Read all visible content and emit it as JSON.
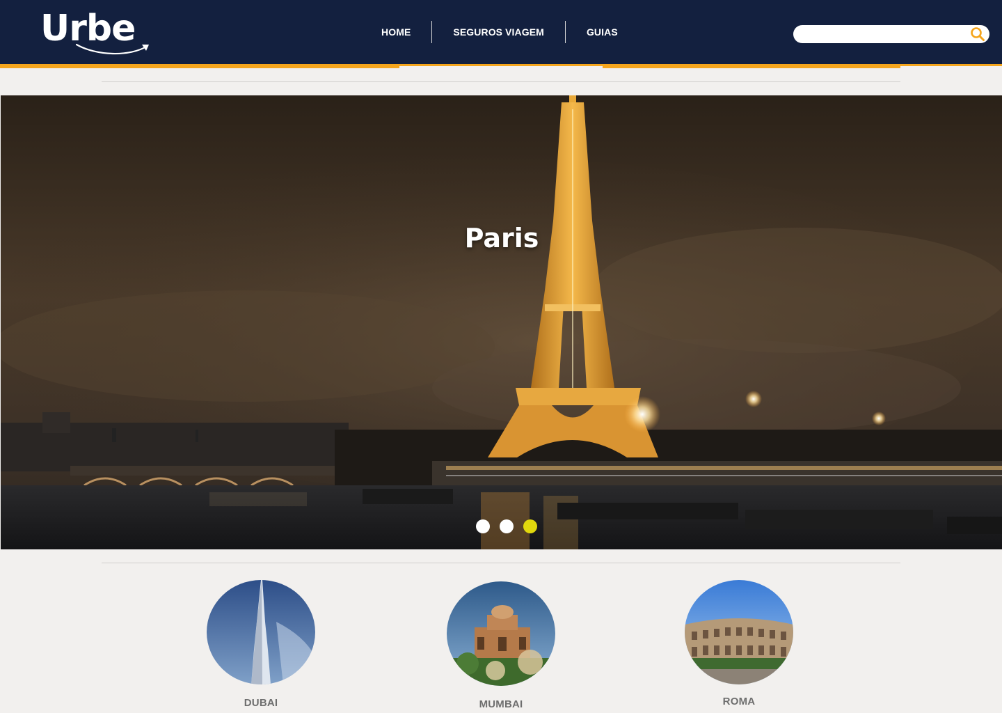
{
  "brand": {
    "name": "Urbe",
    "accent_color": "#f5a51c",
    "header_color": "#13203f"
  },
  "nav": {
    "items": [
      {
        "label": "HOME"
      },
      {
        "label": "SEGUROS VIAGEM"
      },
      {
        "label": "GUIAS"
      }
    ]
  },
  "search": {
    "value": "",
    "placeholder": "",
    "icon": "search-icon"
  },
  "hero": {
    "title": "Paris",
    "slides_total": 3,
    "active_slide": 3,
    "dot_active_color": "#e1d80d"
  },
  "destinations": [
    {
      "name": "DUBAI"
    },
    {
      "name": "MUMBAI"
    },
    {
      "name": "ROMA"
    }
  ]
}
